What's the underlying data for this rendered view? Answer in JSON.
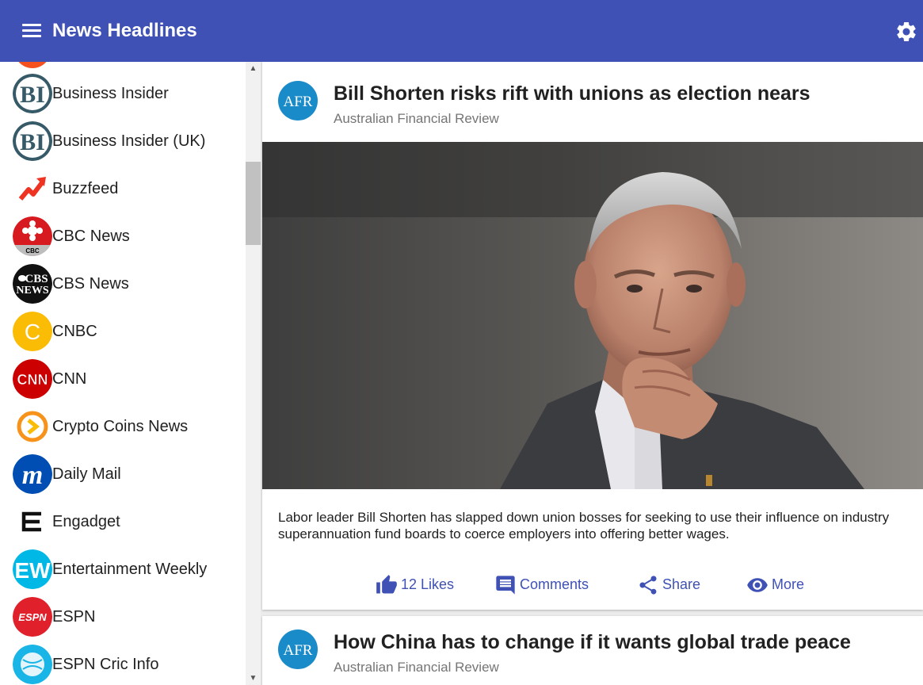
{
  "app": {
    "title": "News Headlines",
    "primary_color": "#3f51b5",
    "menu_icon": "hamburger-menu-icon",
    "settings_icon": "gear-icon"
  },
  "sources": [
    {
      "name": "Business Insider",
      "logo": "business-insider-logo"
    },
    {
      "name": "Business Insider (UK)",
      "logo": "business-insider-logo"
    },
    {
      "name": "Buzzfeed",
      "logo": "buzzfeed-logo"
    },
    {
      "name": "CBC News",
      "logo": "cbc-logo"
    },
    {
      "name": "CBS News",
      "logo": "cbs-logo"
    },
    {
      "name": "CNBC",
      "logo": "cnbc-logo"
    },
    {
      "name": "CNN",
      "logo": "cnn-logo"
    },
    {
      "name": "Crypto Coins News",
      "logo": "crypto-coins-news-logo"
    },
    {
      "name": "Daily Mail",
      "logo": "daily-mail-logo"
    },
    {
      "name": "Engadget",
      "logo": "engadget-logo"
    },
    {
      "name": "Entertainment Weekly",
      "logo": "entertainment-weekly-logo"
    },
    {
      "name": "ESPN",
      "logo": "espn-logo"
    },
    {
      "name": "ESPN Cric Info",
      "logo": "espn-cricinfo-logo"
    }
  ],
  "articles": [
    {
      "title": "Bill Shorten risks rift with unions as election nears",
      "source": "Australian Financial Review",
      "avatar": "AFR",
      "image": "politician-portrait-photo",
      "description": "Labor leader Bill Shorten has slapped down union bosses for seeking to use their influence on industry superannuation fund boards to coerce employers into offering better wages.",
      "actions": {
        "likes": "12 Likes",
        "comments": "Comments",
        "share": "Share",
        "more": "More"
      }
    },
    {
      "title": "How China has to change if it wants global trade peace",
      "source": "Australian Financial Review",
      "avatar": "AFR"
    }
  ]
}
